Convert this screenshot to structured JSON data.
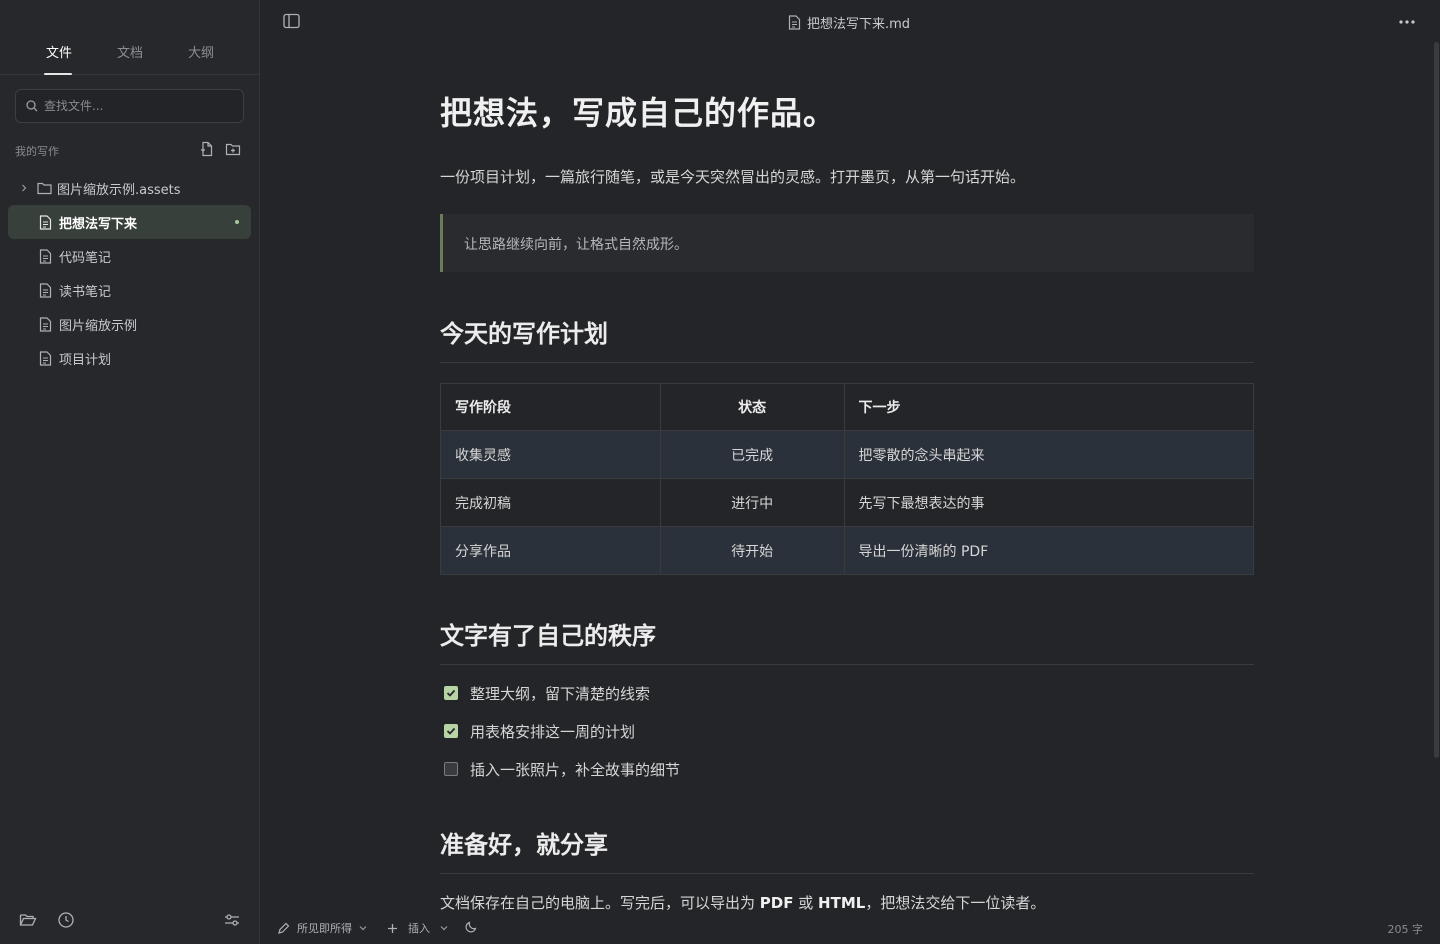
{
  "sidebar": {
    "tabs": [
      "文件",
      "文档",
      "大纲"
    ],
    "search_placeholder": "查找文件...",
    "section_title": "我的写作",
    "items": [
      {
        "label": "图片缩放示例.assets",
        "type": "folder"
      },
      {
        "label": "把想法写下来",
        "type": "file",
        "selected": true
      },
      {
        "label": "代码笔记",
        "type": "file"
      },
      {
        "label": "读书笔记",
        "type": "file"
      },
      {
        "label": "图片缩放示例",
        "type": "file"
      },
      {
        "label": "项目计划",
        "type": "file"
      }
    ]
  },
  "titlebar": {
    "filename": "把想法写下来.md"
  },
  "document": {
    "h1": "把想法，写成自己的作品。",
    "intro": "一份项目计划，一篇旅行随笔，或是今天突然冒出的灵感。打开墨页，从第一句话开始。",
    "quote": "让思路继续向前，让格式自然成形。",
    "h2_plan": "今天的写作计划",
    "table": {
      "headers": [
        "写作阶段",
        "状态",
        "下一步"
      ],
      "rows": [
        [
          "收集灵感",
          "已完成",
          "把零散的念头串起来"
        ],
        [
          "完成初稿",
          "进行中",
          "先写下最想表达的事"
        ],
        [
          "分享作品",
          "待开始",
          "导出一份清晰的 PDF"
        ]
      ]
    },
    "h2_order": "文字有了自己的秩序",
    "tasks": [
      {
        "label": "整理大纲，留下清楚的线索",
        "checked": true
      },
      {
        "label": "用表格安排这一周的计划",
        "checked": true
      },
      {
        "label": "插入一张照片，补全故事的细节",
        "checked": false
      }
    ],
    "h2_share": "准备好，就分享",
    "share_text": {
      "part1": "文档保存在自己的电脑上。写完后，可以导出为 ",
      "pdf": "PDF",
      "or": " 或 ",
      "html": "HTML",
      "part2": "，把想法交给下一位读者。"
    }
  },
  "statusbar": {
    "mode": "所见即所得",
    "insert": "插入",
    "word_count": "205 字"
  },
  "colors": {
    "background": "#242528",
    "sidebar": "#27282b",
    "accent_green": "#b8d3a4",
    "selected_item": "#37403a",
    "table_stripe": "#2b313a"
  },
  "icons": [
    "sidebar-toggle-icon",
    "file-icon",
    "folder-icon",
    "chevron-right-icon",
    "new-file-icon",
    "new-folder-icon",
    "more-icon",
    "search-icon",
    "open-folder-icon",
    "history-icon",
    "settings-sliders-icon",
    "pen-icon",
    "plus-icon",
    "chevron-down-icon",
    "moon-icon"
  ]
}
